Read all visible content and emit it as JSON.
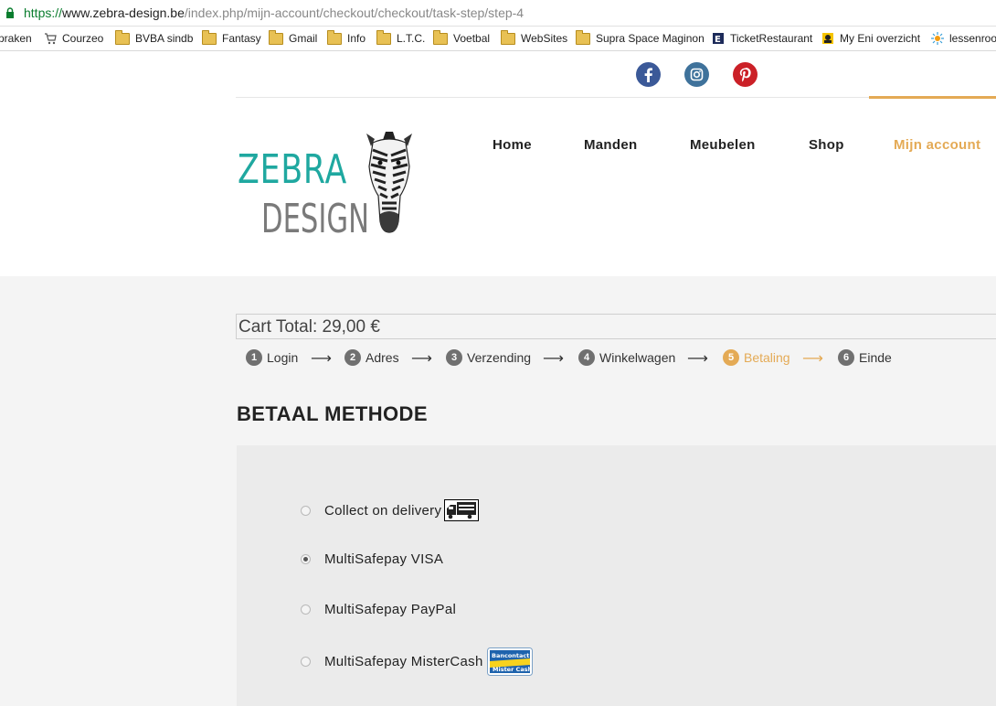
{
  "browser": {
    "url_proto": "https://",
    "url_host": "www.zebra-design.be",
    "url_path": "/index.php/mijn-account/checkout/checkout/task-step/step-4"
  },
  "bookmarks": [
    {
      "label": "praken",
      "icon": "none"
    },
    {
      "label": "Courzeo",
      "icon": "cart-icon"
    },
    {
      "label": "BVBA sindb",
      "icon": "folder-icon"
    },
    {
      "label": "Fantasy",
      "icon": "folder-icon"
    },
    {
      "label": "Gmail",
      "icon": "folder-icon"
    },
    {
      "label": "Info",
      "icon": "folder-icon"
    },
    {
      "label": "L.T.C.",
      "icon": "folder-icon"
    },
    {
      "label": "Voetbal",
      "icon": "folder-icon"
    },
    {
      "label": "WebSites",
      "icon": "folder-icon"
    },
    {
      "label": "Supra Space Maginon",
      "icon": "folder-icon"
    },
    {
      "label": "TicketRestaurant",
      "icon": "ticket-icon"
    },
    {
      "label": "My Eni overzicht",
      "icon": "eni-icon"
    },
    {
      "label": "lessenroo",
      "icon": "sun-icon"
    }
  ],
  "social": [
    {
      "name": "facebook",
      "color": "#3b5998"
    },
    {
      "name": "instagram",
      "color": "#3f729b"
    },
    {
      "name": "pinterest",
      "color": "#cb2027"
    }
  ],
  "logo": {
    "line1": "ZEBRA",
    "line2": "DESIGN",
    "color1": "#1fa8a0",
    "color2": "#7a7a7a"
  },
  "nav": {
    "home": "Home",
    "manden": "Manden",
    "meubelen": "Meubelen",
    "shop": "Shop",
    "account": "Mijn account",
    "accent": "#e4aa55"
  },
  "cart_total": "Cart Total: 29,00 €",
  "steps": [
    {
      "num": "1",
      "label": "Login"
    },
    {
      "num": "2",
      "label": "Adres"
    },
    {
      "num": "3",
      "label": "Verzending"
    },
    {
      "num": "4",
      "label": "Winkelwagen"
    },
    {
      "num": "5",
      "label": "Betaling",
      "active": true
    },
    {
      "num": "6",
      "label": "Einde"
    }
  ],
  "section_title": "BETAAL METHODE",
  "payment_options": [
    {
      "label": "Collect on delivery",
      "checked": false,
      "icon": "delivery-truck-icon"
    },
    {
      "label": "MultiSafepay VISA",
      "checked": true
    },
    {
      "label": "MultiSafepay PayPal",
      "checked": false
    },
    {
      "label": "MultiSafepay MisterCash",
      "checked": false,
      "icon": "bancontact-icon",
      "icon_text1": "Bancontact",
      "icon_text2": "Mister Cash"
    }
  ]
}
